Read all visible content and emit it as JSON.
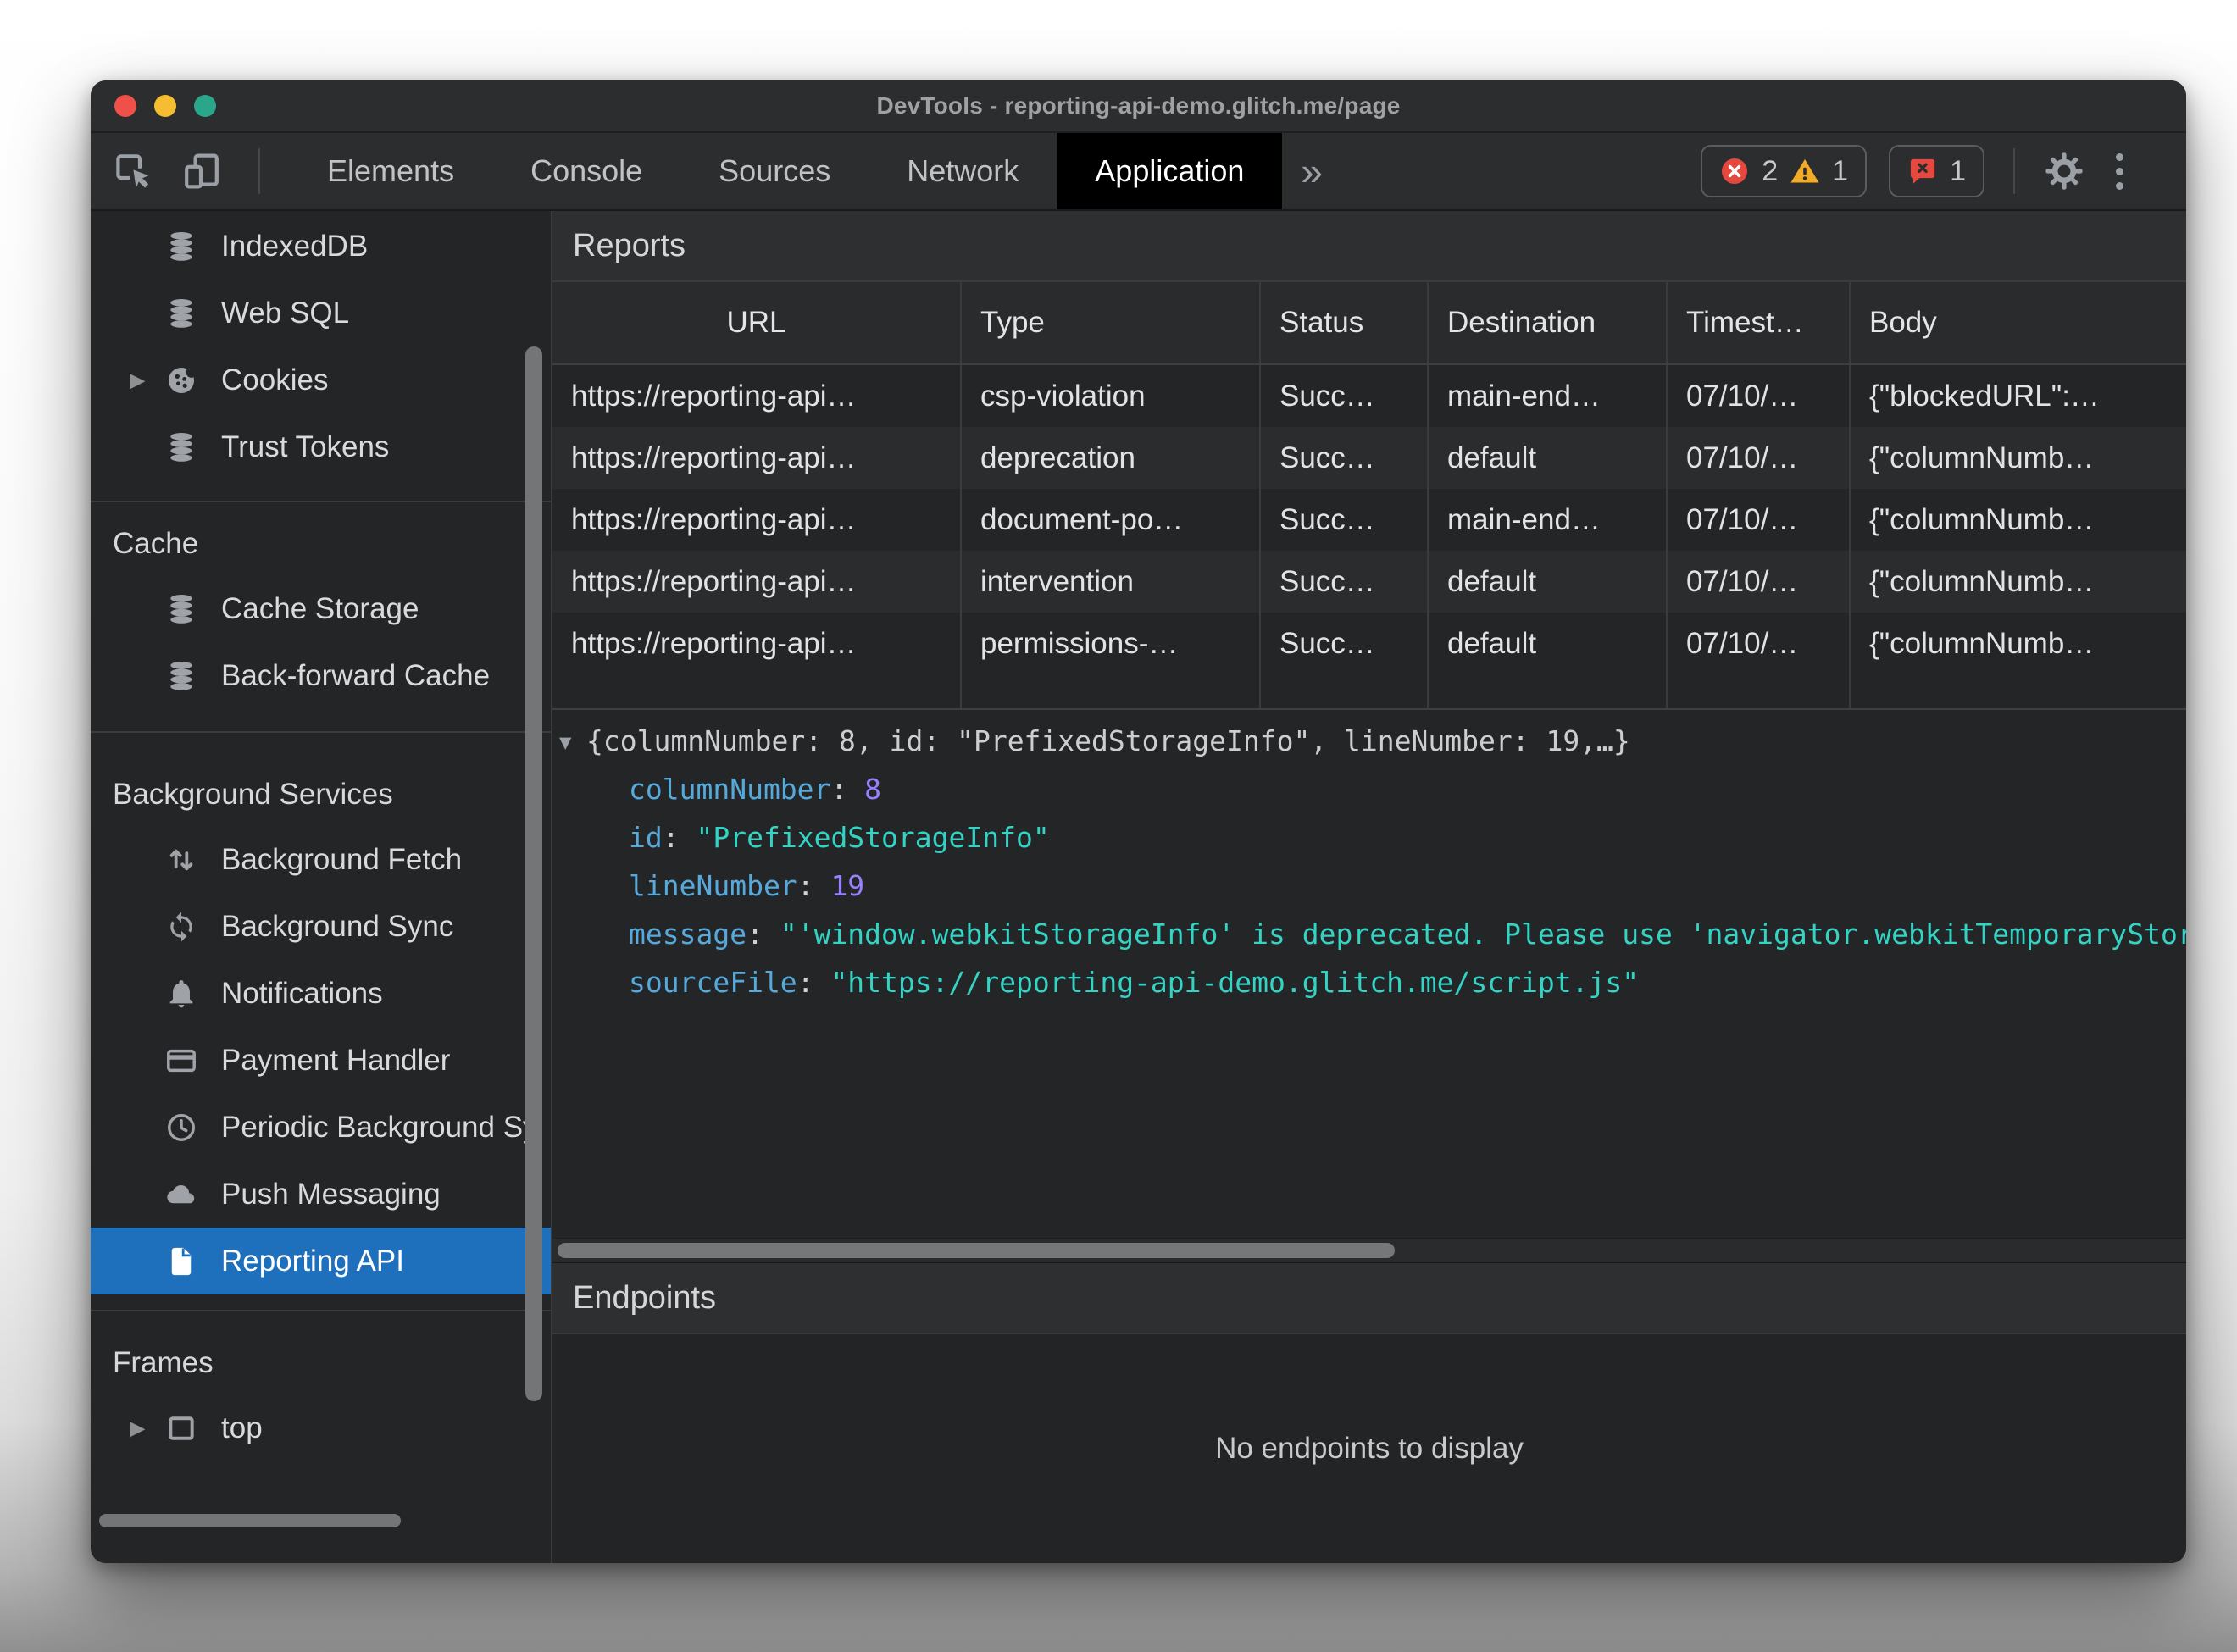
{
  "window": {
    "title": "DevTools - reporting-api-demo.glitch.me/page"
  },
  "toolbar": {
    "tabs": [
      {
        "label": "Elements",
        "active": false
      },
      {
        "label": "Console",
        "active": false
      },
      {
        "label": "Sources",
        "active": false
      },
      {
        "label": "Network",
        "active": false
      },
      {
        "label": "Application",
        "active": true
      }
    ],
    "overflow_chevron": "»",
    "badges": {
      "error_count": "2",
      "warning_count": "1",
      "issue_count": "1"
    }
  },
  "sidebar": {
    "sections": [
      {
        "header": null,
        "items": [
          {
            "icon": "database",
            "label": "IndexedDB"
          },
          {
            "icon": "database",
            "label": "Web SQL"
          },
          {
            "icon": "cookie",
            "label": "Cookies",
            "expandable": true
          },
          {
            "icon": "database",
            "label": "Trust Tokens"
          }
        ]
      },
      {
        "header": "Cache",
        "items": [
          {
            "icon": "database",
            "label": "Cache Storage"
          },
          {
            "icon": "database",
            "label": "Back-forward Cache"
          }
        ]
      },
      {
        "header": "Background Services",
        "items": [
          {
            "icon": "fetch",
            "label": "Background Fetch"
          },
          {
            "icon": "sync",
            "label": "Background Sync"
          },
          {
            "icon": "bell",
            "label": "Notifications"
          },
          {
            "icon": "card",
            "label": "Payment Handler"
          },
          {
            "icon": "clock",
            "label": "Periodic Background Sync"
          },
          {
            "icon": "cloud",
            "label": "Push Messaging"
          },
          {
            "icon": "document",
            "label": "Reporting API",
            "selected": true
          }
        ]
      },
      {
        "header": "Frames",
        "items": [
          {
            "icon": "frame",
            "label": "top",
            "expandable": true
          }
        ]
      }
    ]
  },
  "reports": {
    "title": "Reports",
    "table": {
      "columns": [
        "URL",
        "Type",
        "Status",
        "Destination",
        "Timest…",
        "Body"
      ],
      "rows": [
        [
          "https://reporting-api…",
          "csp-violation",
          "Succ…",
          "main-end…",
          "07/10/…",
          "{\"blockedURL\":…"
        ],
        [
          "https://reporting-api…",
          "deprecation",
          "Succ…",
          "default",
          "07/10/…",
          "{\"columnNumb…"
        ],
        [
          "https://reporting-api…",
          "document-po…",
          "Succ…",
          "main-end…",
          "07/10/…",
          "{\"columnNumb…"
        ],
        [
          "https://reporting-api…",
          "intervention",
          "Succ…",
          "default",
          "07/10/…",
          "{\"columnNumb…"
        ],
        [
          "https://reporting-api…",
          "permissions-…",
          "Succ…",
          "default",
          "07/10/…",
          "{\"columnNumb…"
        ]
      ]
    },
    "detail": {
      "expander_icon": "▼",
      "preview": "{columnNumber: 8, id: \"PrefixedStorageInfo\", lineNumber: 19,…}",
      "properties": [
        {
          "key": "columnNumber",
          "value": "8",
          "type": "number"
        },
        {
          "key": "id",
          "value": "PrefixedStorageInfo",
          "type": "string"
        },
        {
          "key": "lineNumber",
          "value": "19",
          "type": "number"
        },
        {
          "key": "message",
          "value": "'window.webkitStorageInfo' is deprecated. Please use 'navigator.webkitTemporaryStorage' or 'navigator.webkitPersistentStorage' instead.",
          "type": "string"
        },
        {
          "key": "sourceFile",
          "value": "https://reporting-api-demo.glitch.me/script.js",
          "type": "string"
        }
      ]
    }
  },
  "endpoints": {
    "title": "Endpoints",
    "empty_message": "No endpoints to display"
  },
  "colors": {
    "accent_blue": "#1e70bd",
    "error_red": "#e5483f",
    "warning_yellow": "#f2ab26",
    "json_key": "#56aadb",
    "json_number": "#9980ff",
    "json_string": "#34d3c4"
  }
}
